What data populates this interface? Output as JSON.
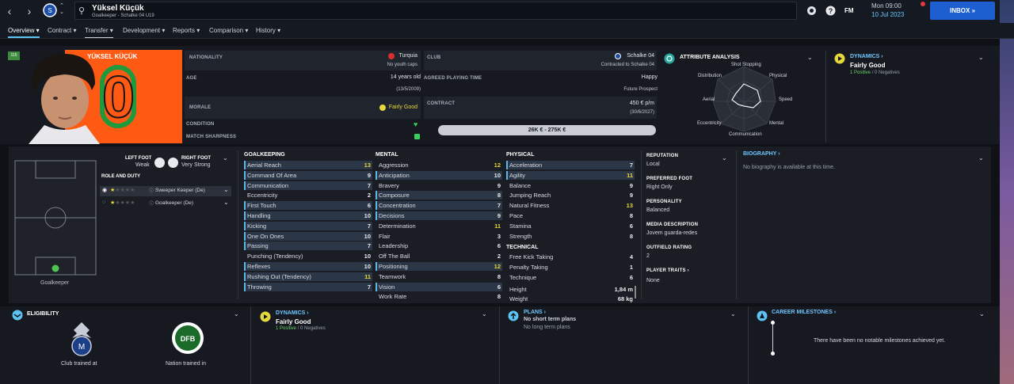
{
  "header": {
    "player_name": "Yüksel Küçük",
    "subtitle": "Goalkeeper - Schalke 04 U19",
    "day_time": "Mon 09:00",
    "date": "10 Jul 2023",
    "inbox_label": "INBOX",
    "fm_label": "FM"
  },
  "tabs": [
    {
      "label": "Overview"
    },
    {
      "label": "Contract"
    },
    {
      "label": "Transfer"
    },
    {
      "label": "Development"
    },
    {
      "label": "Reports"
    },
    {
      "label": "Comparison"
    },
    {
      "label": "History"
    }
  ],
  "profile": {
    "badge": "115",
    "shirt_name": "YÜKSEL KÜÇÜK",
    "shirt_number": "0",
    "nationality_label": "NATIONALITY",
    "nationality": "Turquia",
    "youth_caps": "No youth caps",
    "club_label": "CLUB",
    "club": "Schalke 04",
    "club_contract": "Contracted to Schalke 04",
    "age_label": "AGE",
    "age": "14 years old",
    "dob": "(13/5/2009)",
    "playing_time_label": "AGREED PLAYING TIME",
    "playing_time": "Happy",
    "playing_time_sub": "Future Prospect",
    "morale_label": "MORALE",
    "morale": "Fairly Good",
    "contract_label": "CONTRACT",
    "wage": "450 € p/m",
    "contract_end": "(30/6/2027)",
    "condition_label": "CONDITION",
    "sharpness_label": "MATCH SHARPNESS",
    "value_range": "26K € - 275K €"
  },
  "attribute_analysis": {
    "title": "ATTRIBUTE ANALYSIS",
    "labels": [
      "Shot Stopping",
      "Physical",
      "Speed",
      "Mental",
      "Communication",
      "Eccentricity",
      "Aerial",
      "Distribution"
    ]
  },
  "dynamics_top": {
    "title": "DYNAMICS",
    "value": "Fairly Good",
    "positives": "1 Positive",
    "negatives": "0 Negatives"
  },
  "pitch": {
    "left_foot_label": "LEFT FOOT",
    "left_foot": "Weak",
    "right_foot_label": "RIGHT FOOT",
    "right_foot": "Very Strong",
    "role_title": "ROLE AND DUTY",
    "position": "Goalkeeper",
    "roles": [
      {
        "name": "Sweeper Keeper (De)"
      },
      {
        "name": "Goalkeeper (De)"
      }
    ]
  },
  "goalkeeping": {
    "title": "GOALKEEPING",
    "rows": [
      {
        "name": "Aerial Reach",
        "value": "13",
        "hl": true,
        "y": true
      },
      {
        "name": "Command Of Area",
        "value": "9",
        "hl": true
      },
      {
        "name": "Communication",
        "value": "7",
        "hl": true
      },
      {
        "name": "Eccentricity",
        "value": "2",
        "hl": false
      },
      {
        "name": "First Touch",
        "value": "6",
        "hl": true
      },
      {
        "name": "Handling",
        "value": "10",
        "hl": true
      },
      {
        "name": "Kicking",
        "value": "7",
        "hl": true
      },
      {
        "name": "One On Ones",
        "value": "10",
        "hl": true
      },
      {
        "name": "Passing",
        "value": "7",
        "hl": true
      },
      {
        "name": "Punching (Tendency)",
        "value": "10",
        "hl": false
      },
      {
        "name": "Reflexes",
        "value": "10",
        "hl": true
      },
      {
        "name": "Rushing Out (Tendency)",
        "value": "11",
        "hl": true,
        "y": true
      },
      {
        "name": "Throwing",
        "value": "7",
        "hl": true
      }
    ]
  },
  "mental": {
    "title": "MENTAL",
    "rows": [
      {
        "name": "Aggression",
        "value": "12",
        "hl": false,
        "y": true
      },
      {
        "name": "Anticipation",
        "value": "10",
        "hl": true
      },
      {
        "name": "Bravery",
        "value": "9",
        "hl": false
      },
      {
        "name": "Composure",
        "value": "8",
        "hl": true
      },
      {
        "name": "Concentration",
        "value": "7",
        "hl": true
      },
      {
        "name": "Decisions",
        "value": "9",
        "hl": true
      },
      {
        "name": "Determination",
        "value": "11",
        "hl": false,
        "y": true
      },
      {
        "name": "Flair",
        "value": "3",
        "hl": false
      },
      {
        "name": "Leadership",
        "value": "6",
        "hl": false
      },
      {
        "name": "Off The Ball",
        "value": "2",
        "hl": false
      },
      {
        "name": "Positioning",
        "value": "12",
        "hl": true,
        "y": true
      },
      {
        "name": "Teamwork",
        "value": "8",
        "hl": false
      },
      {
        "name": "Vision",
        "value": "6",
        "hl": true
      },
      {
        "name": "Work Rate",
        "value": "8",
        "hl": false
      }
    ]
  },
  "physical": {
    "title": "PHYSICAL",
    "rows": [
      {
        "name": "Acceleration",
        "value": "7",
        "hl": true
      },
      {
        "name": "Agility",
        "value": "11",
        "hl": true,
        "y": true
      },
      {
        "name": "Balance",
        "value": "9",
        "hl": false
      },
      {
        "name": "Jumping Reach",
        "value": "9",
        "hl": false
      },
      {
        "name": "Natural Fitness",
        "value": "13",
        "hl": false,
        "y": true
      },
      {
        "name": "Pace",
        "value": "8",
        "hl": false
      },
      {
        "name": "Stamina",
        "value": "6",
        "hl": false
      },
      {
        "name": "Strength",
        "value": "8",
        "hl": false
      }
    ]
  },
  "technical": {
    "title": "TECHNICAL",
    "rows": [
      {
        "name": "Free Kick Taking",
        "value": "4",
        "hl": false
      },
      {
        "name": "Penalty Taking",
        "value": "1",
        "hl": false
      },
      {
        "name": "Technique",
        "value": "6",
        "hl": false
      }
    ]
  },
  "measures": {
    "height_label": "Height",
    "height": "1,84 m",
    "weight_label": "Weight",
    "weight": "68 kg"
  },
  "info": {
    "reputation_label": "REPUTATION",
    "reputation": "Local",
    "foot_label": "PREFERRED FOOT",
    "foot": "Right Only",
    "personality_label": "PERSONALITY",
    "personality": "Balanced",
    "media_label": "MEDIA DESCRIPTION",
    "media": "Jovem guarda-redes",
    "outfield_label": "OUTFIELD RATING",
    "outfield": "2",
    "traits_label": "PLAYER TRAITS",
    "traits": "None"
  },
  "biography": {
    "title": "BIOGRAPHY",
    "text": "No biography is available at this time."
  },
  "bottom": {
    "eligibility_title": "ELIGIBILITY",
    "club_trained": "Club trained at",
    "nation_trained": "Nation trained in",
    "dynamics_title": "DYNAMICS",
    "dynamics_value": "Fairly Good",
    "positives": "1 Positive",
    "negatives": "0 Negatives",
    "plans_title": "PLANS",
    "plan1": "No short term plans",
    "plan2": "No long term plans",
    "milestones_title": "CAREER MILESTONES",
    "milestones_text": "There have been no notable milestones achieved yet."
  },
  "colors": {
    "accent": "#5cc3f2",
    "shirt": "#ff5a14",
    "highlight": "#e6d83c",
    "positive": "#6fd26f"
  }
}
